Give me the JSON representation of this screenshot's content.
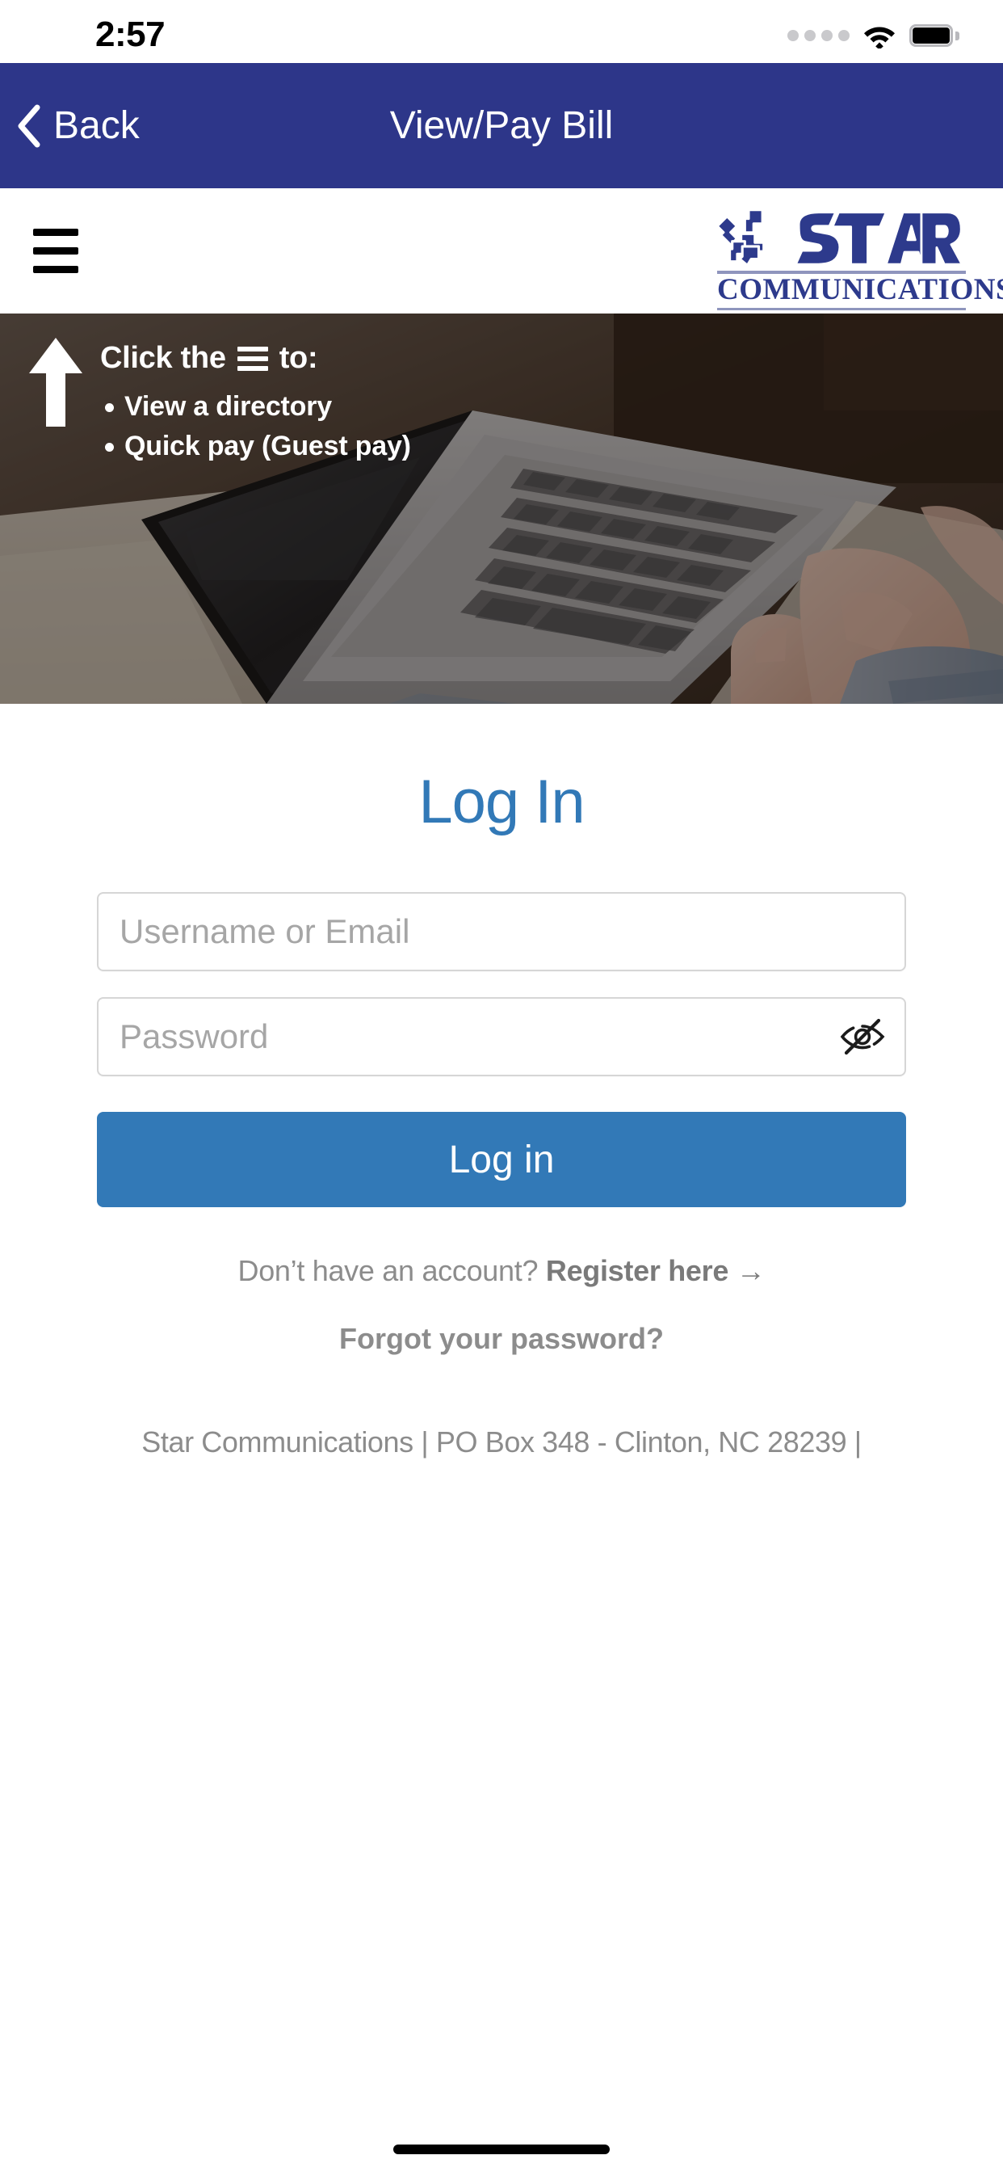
{
  "status_bar": {
    "time": "2:57",
    "signal_icon": "signal-dots-icon",
    "wifi_icon": "wifi-icon",
    "battery_icon": "battery-full-icon"
  },
  "nav_bar": {
    "back_label": "Back",
    "back_icon": "chevron-left-icon",
    "title": "View/Pay Bill",
    "background_color": "#2d3689"
  },
  "site_header": {
    "menu_icon": "hamburger-menu-icon",
    "brand_name": "STAR",
    "brand_subtitle": "COMMUNICATIONS",
    "brand_color": "#2d3a8c"
  },
  "hero": {
    "arrow_icon": "arrow-up-icon",
    "instruction_prefix": "Click the",
    "instruction_icon": "hamburger-menu-icon",
    "instruction_suffix": "to:",
    "bullets": [
      "View a directory",
      "Quick pay (Guest pay)"
    ]
  },
  "login": {
    "title": "Log In",
    "title_color": "#3279b7",
    "username_placeholder": "Username or Email",
    "username_value": "",
    "password_placeholder": "Password",
    "password_value": "",
    "toggle_password_icon": "eye-slash-icon",
    "submit_label": "Log in",
    "submit_color": "#3279b7",
    "register_prompt": "Don’t have an account?",
    "register_link": "Register here →",
    "forgot_link": "Forgot your password?"
  },
  "footer": {
    "text": "Star Communications | PO Box 348 - Clinton, NC 28239 |"
  }
}
